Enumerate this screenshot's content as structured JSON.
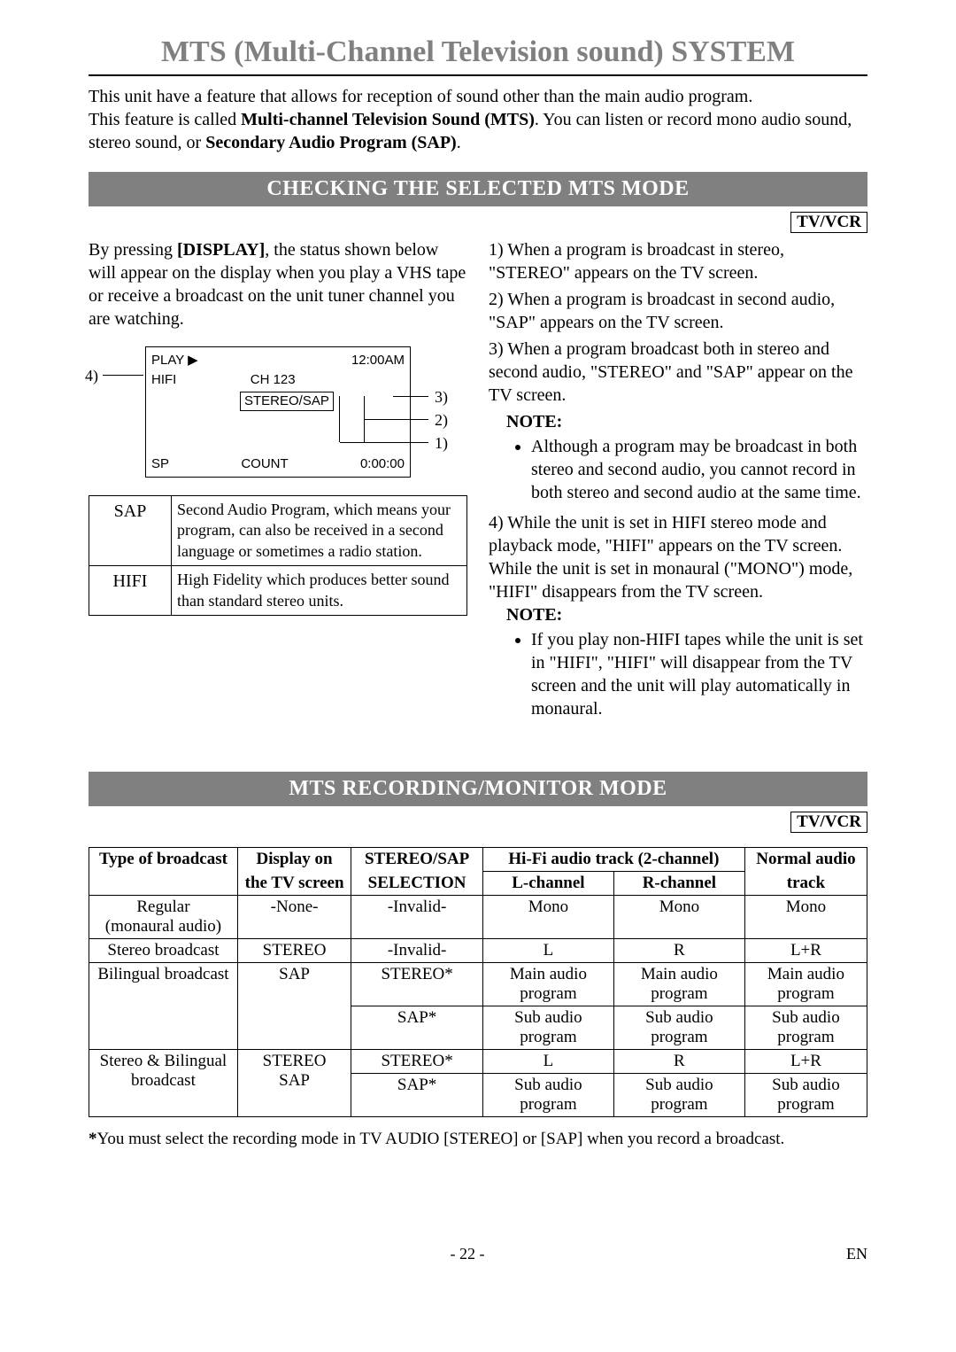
{
  "main_title": "MTS (Multi-Channel Television sound) SYSTEM",
  "intro_line1": "This unit have a feature that allows for reception of sound other than the main audio program.",
  "intro_line2a": "This feature is called ",
  "intro_line2b": "Multi-channel Television Sound (MTS)",
  "intro_line2c": ". You can listen or record mono audio sound, stereo sound, or ",
  "intro_line2d": "Secondary Audio Program (SAP)",
  "intro_line2e": ".",
  "section1": {
    "heading": "CHECKING THE SELECTED MTS MODE",
    "badge": "TV/VCR",
    "left_intro_a": "By pressing ",
    "left_intro_b": "[DISPLAY]",
    "left_intro_c": ", the status shown below will appear on the display when you play a VHS tape or receive a broadcast on the unit tuner channel you are watching.",
    "osd": {
      "play": "PLAY ▶",
      "time": "12:00AM",
      "hifi": "HIFI",
      "ch": "CH 123",
      "stereo_sap": "STEREO/SAP",
      "sp": "SP",
      "count": "COUNT",
      "counter": "0:00:00",
      "callout_4": "4)",
      "callout_3": "3)",
      "callout_2": "2)",
      "callout_1": "1)"
    },
    "ref_rows": [
      {
        "term": "SAP",
        "desc": "Second Audio Program, which means your program, can also be received in a second language or sometimes a radio station."
      },
      {
        "term": "HIFI",
        "desc": "High Fidelity which produces better sound than standard stereo units."
      }
    ],
    "right_list": [
      "1) When a program is broadcast in stereo, \"STEREO\" appears on the TV screen.",
      "2) When a program is broadcast in second audio, \"SAP\" appears on the TV screen.",
      "3) When a program broadcast both in stereo and second audio, \"STEREO\" and \"SAP\" appear on the TV screen."
    ],
    "note1_label": "NOTE:",
    "note1_bullet": "Although a program may be broadcast in both stereo and second audio, you cannot record in both stereo and second audio at the same time.",
    "right_item4": "4) While the unit is set in HIFI stereo mode and playback mode, \"HIFI\" appears on the TV screen. While the unit is set in monaural (\"MONO\") mode, \"HIFI\" disappears from the TV screen.",
    "note2_label": "NOTE:",
    "note2_bullet": "If you play non-HIFI tapes while the unit is set in \"HIFI\", \"HIFI\" will disappear from the TV screen and the unit will play automatically in monaural."
  },
  "section2": {
    "heading": "MTS RECORDING/MONITOR MODE",
    "badge": "TV/VCR",
    "headers": {
      "type": "Type of broadcast",
      "display1": "Display on",
      "display2": "the TV screen",
      "ss1": "STEREO/SAP",
      "ss2": "SELECTION",
      "hifi": "Hi-Fi audio track (2-channel)",
      "l": "L-channel",
      "r": "R-channel",
      "norm1": "Normal audio",
      "norm2": "track"
    },
    "rows": [
      {
        "type": "Regular\n(monaural audio)",
        "disp": "-None-",
        "ss": "-Invalid-",
        "l": "Mono",
        "r": "Mono",
        "n": "Mono"
      },
      {
        "type": "Stereo broadcast",
        "disp": "STEREO",
        "ss": "-Invalid-",
        "l": "L",
        "r": "R",
        "n": "L+R"
      },
      {
        "type": "Bilingual broadcast",
        "disp": "SAP",
        "ss": "STEREO*",
        "l": "Main audio\nprogram",
        "r": "Main audio\nprogram",
        "n": "Main audio\nprogram"
      },
      {
        "type": "",
        "disp": "",
        "ss": "SAP*",
        "l": "Sub audio\nprogram",
        "r": "Sub audio\nprogram",
        "n": "Sub audio\nprogram"
      },
      {
        "type": "Stereo & Bilingual\nbroadcast",
        "disp": "STEREO\nSAP",
        "ss": "STEREO*",
        "l": "L",
        "r": "R",
        "n": "L+R"
      },
      {
        "type": "",
        "disp": "",
        "ss": "SAP*",
        "l": "Sub audio\nprogram",
        "r": "Sub audio\nprogram",
        "n": "Sub audio\nprogram"
      }
    ],
    "footnote_star": "*",
    "footnote_text": "You must select the recording mode in TV AUDIO [STEREO] or [SAP] when you record a broadcast."
  },
  "footer": {
    "page": "- 22 -",
    "lang": "EN"
  }
}
